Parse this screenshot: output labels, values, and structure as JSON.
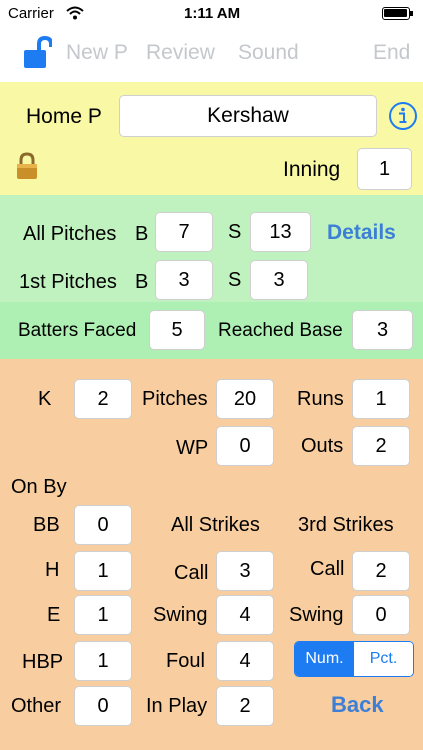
{
  "status": {
    "carrier": "Carrier",
    "time": "1:11 AM"
  },
  "nav": {
    "new_p": "New P",
    "review": "Review",
    "sound": "Sound",
    "end": "End"
  },
  "pitcher": {
    "label": "Home P",
    "name": "Kershaw",
    "inning_label": "Inning",
    "inning": "1"
  },
  "pitches": {
    "all_label": "All Pitches",
    "first_label": "1st Pitches",
    "b_label": "B",
    "s_label": "S",
    "all_b": "7",
    "all_s": "13",
    "first_b": "3",
    "first_s": "3",
    "details": "Details"
  },
  "batters": {
    "faced_label": "Batters Faced",
    "faced": "5",
    "reached_label": "Reached Base",
    "reached": "3"
  },
  "stats": {
    "k_label": "K",
    "k": "2",
    "pitches_label": "Pitches",
    "pitches": "20",
    "runs_label": "Runs",
    "runs": "1",
    "wp_label": "WP",
    "wp": "0",
    "outs_label": "Outs",
    "outs": "2"
  },
  "on_by": {
    "title": "On By",
    "bb_label": "BB",
    "bb": "0",
    "h_label": "H",
    "h": "1",
    "e_label": "E",
    "e": "1",
    "hbp_label": "HBP",
    "hbp": "1",
    "other_label": "Other",
    "other": "0"
  },
  "all_strikes": {
    "title": "All Strikes",
    "call_label": "Call",
    "call": "3",
    "swing_label": "Swing",
    "swing": "4",
    "foul_label": "Foul",
    "foul": "4",
    "inplay_label": "In Play",
    "inplay": "2"
  },
  "third_strikes": {
    "title": "3rd Strikes",
    "call_label": "Call",
    "call": "2",
    "swing_label": "Swing",
    "swing": "0"
  },
  "mode": {
    "num": "Num.",
    "pct": "Pct."
  },
  "back": "Back",
  "colors": {
    "accent": "#1e7cf2",
    "link": "#3d7fd6",
    "yellow": "#f9f8a4",
    "green": "#c0f2bf",
    "orange": "#f8cea0"
  }
}
